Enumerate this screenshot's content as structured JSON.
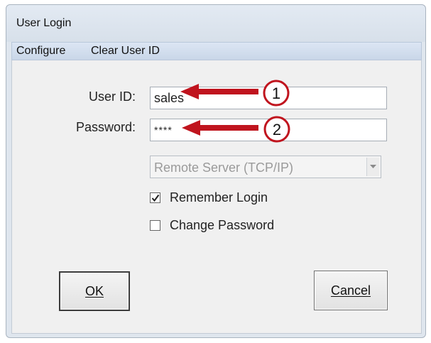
{
  "window": {
    "title": "User Login"
  },
  "menu": {
    "items": [
      "Configure",
      "Clear User ID"
    ]
  },
  "form": {
    "user_id_label": "User ID:",
    "user_id_value": "sales",
    "password_label": "Password:",
    "password_value": "****",
    "server_selected": "Remote Server (TCP/IP)",
    "remember_login_label": "Remember Login",
    "remember_login_checked": true,
    "change_password_label": "Change Password",
    "change_password_checked": false
  },
  "buttons": {
    "ok_label": "OK",
    "cancel_label": "Cancel"
  },
  "annotations": {
    "step1": "1",
    "step2": "2",
    "arrow_color": "#c0141e",
    "circle_fill": "#ffffff"
  }
}
